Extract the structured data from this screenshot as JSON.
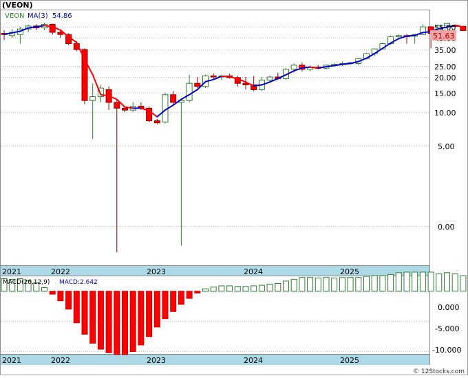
{
  "header": {
    "ticker_label": "(VEON)",
    "legend_symbol": "VEON",
    "legend_ma": "MA(3)",
    "legend_ma_value": "54.86"
  },
  "price_panel": {
    "last_price_label": "51.63",
    "y_tick_labels": [
      "55.00",
      "45.00",
      "35.00",
      "25.00",
      "20.00",
      "15.00",
      "10.00",
      "5.00",
      "0.00"
    ],
    "x_tick_labels": [
      "2021",
      "2022",
      "2023",
      "2024",
      "2025"
    ]
  },
  "macd_panel": {
    "label": "MACD(26,12,9)",
    "value_label": "MACD:2.642",
    "y_tick_labels": [
      "0.000",
      "-5.000",
      "-10.000"
    ],
    "x_tick_labels": [
      "2021",
      "2022",
      "2023",
      "2024",
      "2025"
    ]
  },
  "footer": {
    "credit": "© 12Stocks.com"
  },
  "colors": {
    "up": "#228b22",
    "down": "#ff0000",
    "ma_up": "#0000cd",
    "ma_down": "#ff0000",
    "axis_band": "#add8e6",
    "price_label_bg": "#f4a6a6",
    "grid": "#999999"
  },
  "chart_data": [
    {
      "type": "candlestick",
      "title": "(VEON)",
      "series_name": "VEON",
      "y_scale": "log-like",
      "ylim": [
        0,
        60
      ],
      "x_range": [
        "2021-01",
        "2025-09"
      ],
      "candles": [
        {
          "t": "2021-01",
          "o": 49.0,
          "h": 52.0,
          "l": 43.0,
          "c": 48.0
        },
        {
          "t": "2021-02",
          "o": 47.0,
          "h": 53.0,
          "l": 45.0,
          "c": 50.0
        },
        {
          "t": "2021-03",
          "o": 48.0,
          "h": 55.0,
          "l": 40.0,
          "c": 53.0
        },
        {
          "t": "2021-04",
          "o": 53.0,
          "h": 58.0,
          "l": 50.0,
          "c": 56.0
        },
        {
          "t": "2021-05",
          "o": 56.0,
          "h": 58.0,
          "l": 52.0,
          "c": 54.0
        },
        {
          "t": "2021-06",
          "o": 54.0,
          "h": 60.0,
          "l": 52.0,
          "c": 58.0
        },
        {
          "t": "2021-07",
          "o": 58.0,
          "h": 59.0,
          "l": 48.0,
          "c": 50.0
        },
        {
          "t": "2021-08",
          "o": 50.0,
          "h": 52.0,
          "l": 45.0,
          "c": 48.0
        },
        {
          "t": "2021-09",
          "o": 48.0,
          "h": 49.0,
          "l": 39.0,
          "c": 40.0
        },
        {
          "t": "2021-10",
          "o": 40.0,
          "h": 42.0,
          "l": 34.0,
          "c": 35.0
        },
        {
          "t": "2021-11",
          "o": 35.0,
          "h": 36.0,
          "l": 12.0,
          "c": 13.0
        },
        {
          "t": "2021-12",
          "o": 13.0,
          "h": 18.0,
          "l": 6.0,
          "c": 14.0
        },
        {
          "t": "2022-01",
          "o": 14.0,
          "h": 17.5,
          "l": 12.5,
          "c": 16.5
        },
        {
          "t": "2022-02",
          "o": 16.0,
          "h": 17.0,
          "l": 10.5,
          "c": 12.5
        },
        {
          "t": "2022-03",
          "o": 12.5,
          "h": 13.0,
          "l": -2.0,
          "c": 11.0
        },
        {
          "t": "2022-04",
          "o": 11.0,
          "h": 11.5,
          "l": 10.0,
          "c": 10.5
        },
        {
          "t": "2022-05",
          "o": 10.5,
          "h": 12.5,
          "l": 10.0,
          "c": 11.5
        },
        {
          "t": "2022-06",
          "o": 11.5,
          "h": 12.5,
          "l": 10.5,
          "c": 11.0
        },
        {
          "t": "2022-07",
          "o": 11.0,
          "h": 11.5,
          "l": 8.5,
          "c": 8.7
        },
        {
          "t": "2022-08",
          "o": 8.7,
          "h": 9.0,
          "l": 8.2,
          "c": 8.4
        },
        {
          "t": "2022-09",
          "o": 8.5,
          "h": 15.0,
          "l": 8.3,
          "c": 14.5
        },
        {
          "t": "2022-10",
          "o": 14.5,
          "h": 15.5,
          "l": 12.0,
          "c": 12.5
        },
        {
          "t": "2022-11",
          "o": 12.5,
          "h": 13.5,
          "l": -1.5,
          "c": 13.0
        },
        {
          "t": "2022-12",
          "o": 13.0,
          "h": 21.0,
          "l": 12.5,
          "c": 18.0
        },
        {
          "t": "2023-01",
          "o": 18.0,
          "h": 20.0,
          "l": 16.5,
          "c": 17.0
        },
        {
          "t": "2023-02",
          "o": 17.0,
          "h": 21.0,
          "l": 16.5,
          "c": 20.5
        },
        {
          "t": "2023-03",
          "o": 20.5,
          "h": 21.5,
          "l": 19.5,
          "c": 20.0
        },
        {
          "t": "2023-04",
          "o": 20.0,
          "h": 21.0,
          "l": 19.0,
          "c": 20.5
        },
        {
          "t": "2023-05",
          "o": 20.5,
          "h": 21.5,
          "l": 19.5,
          "c": 19.8
        },
        {
          "t": "2023-06",
          "o": 19.8,
          "h": 20.5,
          "l": 17.0,
          "c": 18.0
        },
        {
          "t": "2023-07",
          "o": 18.0,
          "h": 20.0,
          "l": 16.0,
          "c": 17.5
        },
        {
          "t": "2023-08",
          "o": 17.5,
          "h": 20.5,
          "l": 15.5,
          "c": 16.0
        },
        {
          "t": "2023-09",
          "o": 16.0,
          "h": 20.0,
          "l": 15.5,
          "c": 19.0
        },
        {
          "t": "2023-10",
          "o": 19.0,
          "h": 20.5,
          "l": 18.5,
          "c": 20.0
        },
        {
          "t": "2023-11",
          "o": 20.0,
          "h": 22.0,
          "l": 19.0,
          "c": 19.5
        },
        {
          "t": "2023-12",
          "o": 19.5,
          "h": 24.0,
          "l": 19.0,
          "c": 23.5
        },
        {
          "t": "2024-01",
          "o": 23.5,
          "h": 26.5,
          "l": 22.0,
          "c": 25.5
        },
        {
          "t": "2024-02",
          "o": 25.5,
          "h": 27.0,
          "l": 22.5,
          "c": 23.5
        },
        {
          "t": "2024-03",
          "o": 23.5,
          "h": 25.5,
          "l": 22.5,
          "c": 24.5
        },
        {
          "t": "2024-04",
          "o": 24.5,
          "h": 25.5,
          "l": 23.5,
          "c": 24.0
        },
        {
          "t": "2024-05",
          "o": 24.0,
          "h": 26.0,
          "l": 23.5,
          "c": 25.5
        },
        {
          "t": "2024-06",
          "o": 25.5,
          "h": 27.0,
          "l": 25.0,
          "c": 26.0
        },
        {
          "t": "2024-07",
          "o": 26.0,
          "h": 27.5,
          "l": 25.0,
          "c": 26.5
        },
        {
          "t": "2024-08",
          "o": 26.5,
          "h": 27.5,
          "l": 26.0,
          "c": 27.0
        },
        {
          "t": "2024-09",
          "o": 26.5,
          "h": 30.0,
          "l": 25.5,
          "c": 29.5
        },
        {
          "t": "2024-10",
          "o": 29.5,
          "h": 33.0,
          "l": 29.0,
          "c": 32.5
        },
        {
          "t": "2024-11",
          "o": 32.5,
          "h": 36.0,
          "l": 31.0,
          "c": 35.5
        },
        {
          "t": "2024-12",
          "o": 35.5,
          "h": 41.0,
          "l": 35.0,
          "c": 40.0
        },
        {
          "t": "2025-01",
          "o": 40.0,
          "h": 47.0,
          "l": 39.0,
          "c": 46.0
        },
        {
          "t": "2025-02",
          "o": 46.0,
          "h": 48.0,
          "l": 44.0,
          "c": 47.0
        },
        {
          "t": "2025-03",
          "o": 47.0,
          "h": 48.5,
          "l": 40.0,
          "c": 46.5
        },
        {
          "t": "2025-04",
          "o": 46.5,
          "h": 48.5,
          "l": 40.0,
          "c": 48.0
        },
        {
          "t": "2025-05",
          "o": 48.0,
          "h": 58.0,
          "l": 47.5,
          "c": 55.0
        },
        {
          "t": "2025-06",
          "o": 55.0,
          "h": 56.0,
          "l": 36.0,
          "c": 49.0
        },
        {
          "t": "2025-07",
          "o": 49.0,
          "h": 57.0,
          "l": 48.5,
          "c": 56.0
        },
        {
          "t": "2025-08",
          "o": 56.0,
          "h": 61.0,
          "l": 54.0,
          "c": 59.0
        },
        {
          "t": "2025-09",
          "o": 57.0,
          "h": 58.0,
          "l": 54.5,
          "c": 55.5
        },
        {
          "t": "2025-10",
          "o": 55.5,
          "h": 56.5,
          "l": 51.0,
          "c": 51.6
        }
      ],
      "moving_average": {
        "name": "MA(3)",
        "values": [
          48,
          49.5,
          51,
          54,
          55,
          56.5,
          55,
          52,
          46,
          41,
          29,
          21,
          14.5,
          14.2,
          13.3,
          11.3,
          11.0,
          11.0,
          10.3,
          9.3,
          10.5,
          11.8,
          13.3,
          14.5,
          16.0,
          18.5,
          19.2,
          20.3,
          20.1,
          19.4,
          18.4,
          17.2,
          17.5,
          18.4,
          19.5,
          21.0,
          22.8,
          24.1,
          24.5,
          24.0,
          24.7,
          25.2,
          26.0,
          26.5,
          27.7,
          29.7,
          32.5,
          36.0,
          40.5,
          44.3,
          46.5,
          47.2,
          49.8,
          50.7,
          53.3,
          54.7,
          56.8,
          54.9
        ]
      }
    },
    {
      "type": "bar",
      "title": "MACD(26,12,9)",
      "series_name": "MACD",
      "ylim": [
        -10.5,
        2.5
      ],
      "values": [
        2.1,
        2.0,
        2.1,
        1.8,
        1.4,
        0.6,
        -0.5,
        -1.6,
        -3.0,
        -5.3,
        -7.2,
        -8.7,
        -9.7,
        -10.3,
        -10.6,
        -10.6,
        -10.1,
        -9.0,
        -7.6,
        -6.0,
        -4.6,
        -3.4,
        -2.2,
        -1.2,
        -0.3,
        0.4,
        0.7,
        0.9,
        0.9,
        0.8,
        0.8,
        0.9,
        1.0,
        1.2,
        1.3,
        1.7,
        2.0,
        2.3,
        2.3,
        2.2,
        2.3,
        2.2,
        2.3,
        2.3,
        2.3,
        2.5,
        2.6,
        2.6,
        2.8,
        3.1,
        3.2,
        3.2,
        3.2,
        3.2,
        2.9,
        3.1,
        2.9,
        2.6
      ],
      "zero_line": true
    }
  ]
}
